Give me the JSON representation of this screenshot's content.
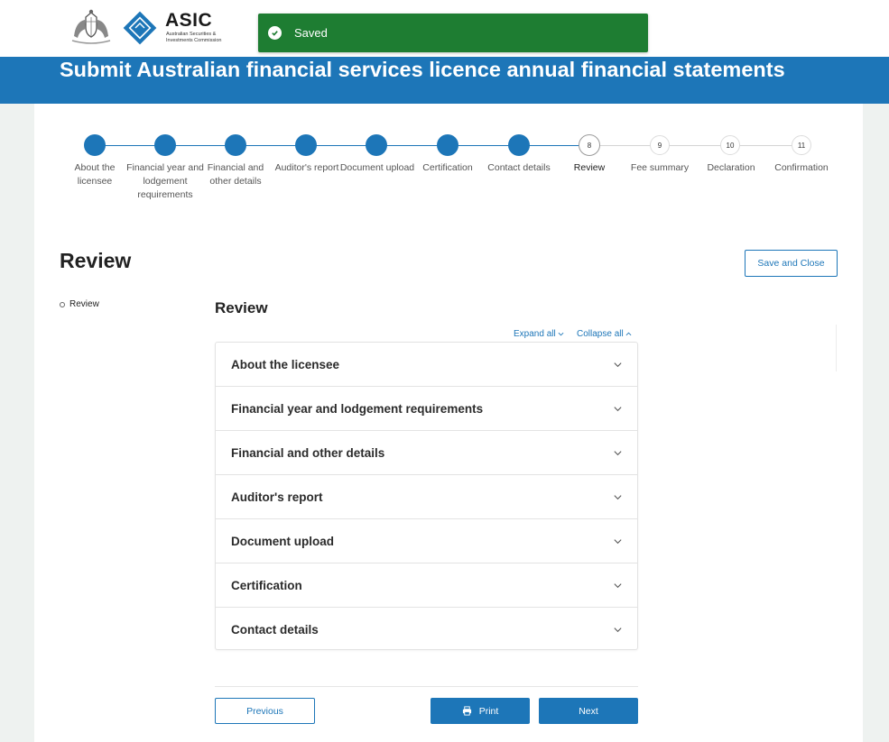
{
  "header": {
    "logo_name": "ASIC",
    "logo_subtitle": "Australian Securities & Investments Commission",
    "crest_icon": "coat-of-arms-icon",
    "logo_icon": "asic-diamond-icon"
  },
  "toast": {
    "message": "Saved",
    "icon": "check-circle-icon",
    "color": "#1e7d32"
  },
  "banner": {
    "title": "Submit Australian financial services licence annual financial statements",
    "color": "#1d76b8"
  },
  "stepper": {
    "current_step": 8,
    "steps": [
      {
        "number": "1",
        "label": "About the licensee",
        "status": "complete"
      },
      {
        "number": "2",
        "label": "Financial year and lodgement requirements",
        "status": "complete"
      },
      {
        "number": "3",
        "label": "Financial and other details",
        "status": "complete"
      },
      {
        "number": "4",
        "label": "Auditor's report",
        "status": "complete"
      },
      {
        "number": "5",
        "label": "Document upload",
        "status": "complete"
      },
      {
        "number": "6",
        "label": "Certification",
        "status": "complete"
      },
      {
        "number": "7",
        "label": "Contact details",
        "status": "complete"
      },
      {
        "number": "8",
        "label": "Review",
        "status": "current"
      },
      {
        "number": "9",
        "label": "Fee summary",
        "status": "todo"
      },
      {
        "number": "10",
        "label": "Declaration",
        "status": "todo"
      },
      {
        "number": "11",
        "label": "Confirmation",
        "status": "todo"
      }
    ]
  },
  "page": {
    "title": "Review",
    "save_close_label": "Save and Close"
  },
  "side_nav": {
    "items": [
      {
        "label": "Review"
      }
    ]
  },
  "review_section": {
    "title": "Review",
    "expand_all_label": "Expand all",
    "collapse_all_label": "Collapse all",
    "accordion": [
      {
        "label": "About the licensee"
      },
      {
        "label": "Financial year and lodgement requirements"
      },
      {
        "label": "Financial and other details"
      },
      {
        "label": "Auditor's report"
      },
      {
        "label": "Document upload"
      },
      {
        "label": "Certification"
      },
      {
        "label": "Contact details"
      }
    ]
  },
  "footer_buttons": {
    "previous_label": "Previous",
    "print_label": "Print",
    "next_label": "Next"
  }
}
